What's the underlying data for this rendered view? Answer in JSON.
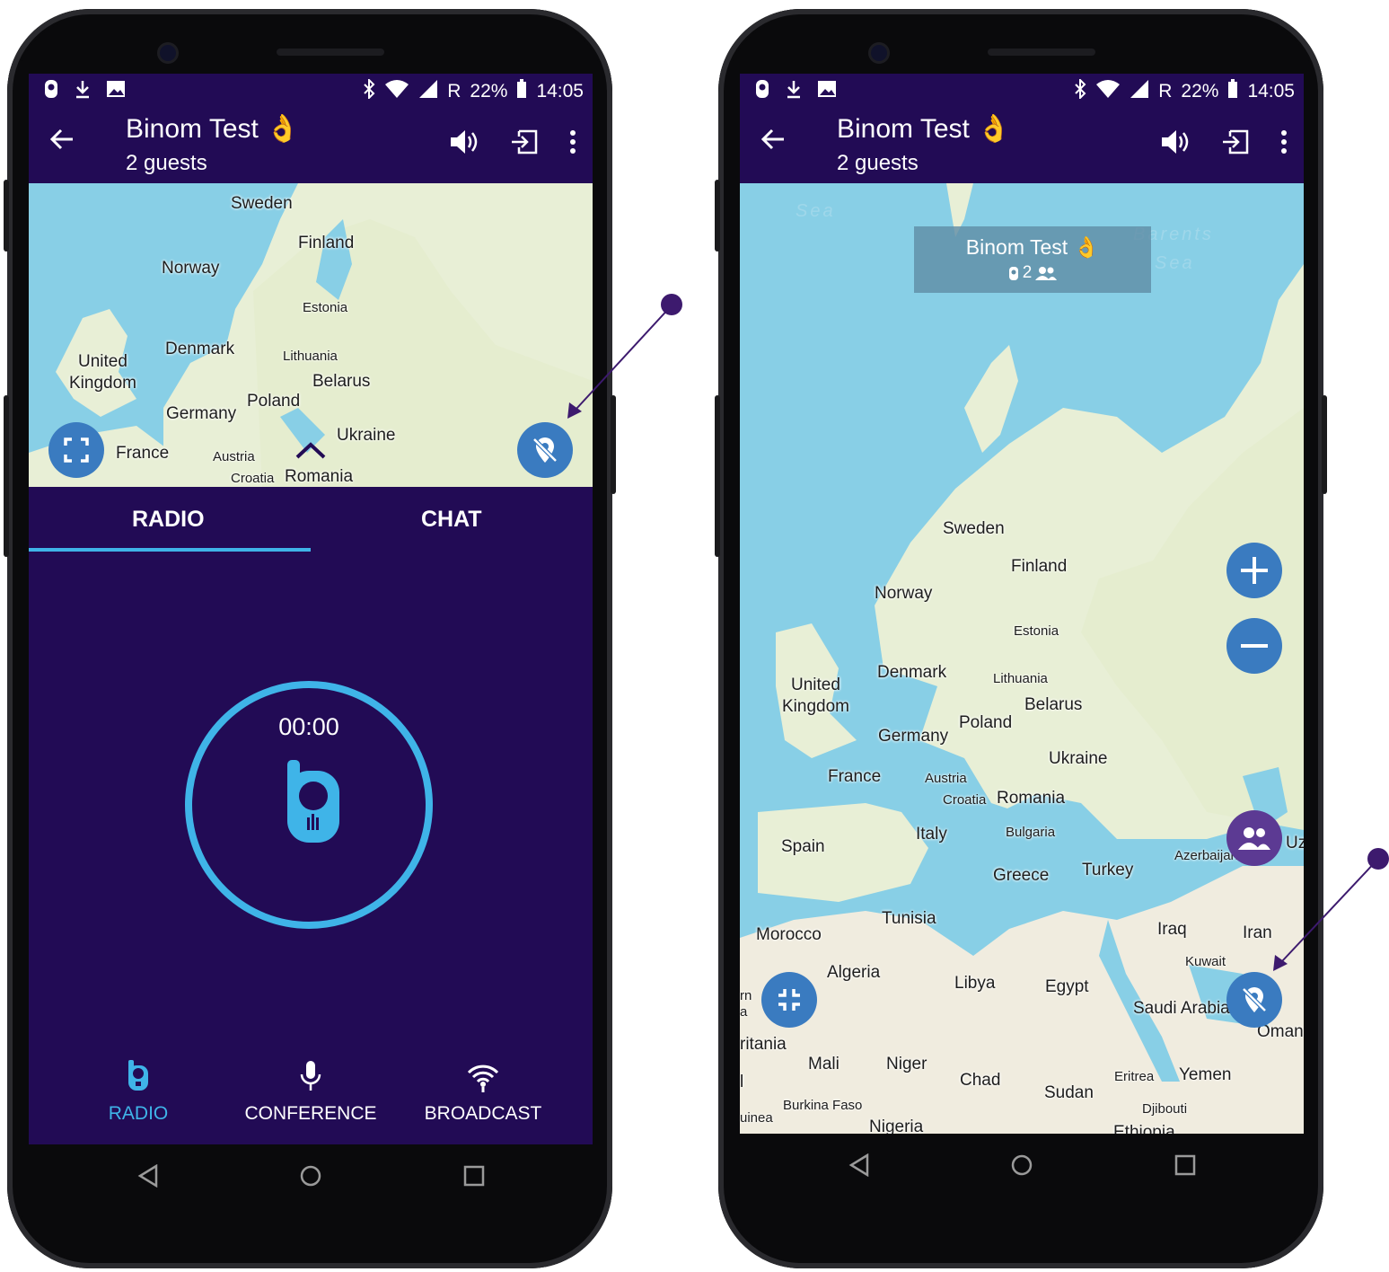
{
  "colors": {
    "primary": "#220b55",
    "accent": "#3fb4e8",
    "fab": "#3a7bc0",
    "pointer": "#3d1a6e"
  },
  "status": {
    "battery": "22%",
    "roaming": "R",
    "time": "14:05"
  },
  "appbar": {
    "title": "Binom Test",
    "subtitle": "2 guests",
    "emoji": "👌"
  },
  "left_phone": {
    "map_labels": [
      "Sweden",
      "Finland",
      "Norway",
      "Estonia",
      "Denmark",
      "Lithuania",
      "United",
      "Kingdom",
      "Belarus",
      "Poland",
      "Germany",
      "Ukraine",
      "France",
      "Austria",
      "Croatia",
      "Romania"
    ],
    "tabs": [
      {
        "label": "RADIO",
        "selected": true
      },
      {
        "label": "CHAT",
        "selected": false
      }
    ],
    "timer": "00:00",
    "bottom_nav": [
      {
        "label": "RADIO",
        "icon": "walkie-talkie-icon",
        "selected": true
      },
      {
        "label": "CONFERENCE",
        "icon": "microphone-icon",
        "selected": false
      },
      {
        "label": "BROADCAST",
        "icon": "broadcast-icon",
        "selected": false
      }
    ]
  },
  "right_phone": {
    "group_label": {
      "title": "Binom Test",
      "count": "2"
    },
    "seas": [
      "Sea",
      "Barents",
      "Sea"
    ],
    "map_labels": [
      "Sweden",
      "Finland",
      "Norway",
      "Estonia",
      "United",
      "Kingdom",
      "Denmark",
      "Lithuania",
      "Belarus",
      "Germany",
      "Poland",
      "Ukraine",
      "France",
      "Austria",
      "Croatia",
      "Romania",
      "Bulgaria",
      "Italy",
      "Spain",
      "Azerbaijan",
      "Uz",
      "Greece",
      "Turkey",
      "Tunisia",
      "Morocco",
      "Iraq",
      "Iran",
      "Kuwait",
      "Algeria",
      "Libya",
      "Egypt",
      "Saudi Arabia",
      "Oman",
      "rn",
      "a",
      "ritania",
      "Mali",
      "Niger",
      "Chad",
      "Sudan",
      "Eritrea",
      "Yemen",
      "l",
      "Burkina Faso",
      "Djibouti",
      "uinea",
      "Nigeria",
      "Ethiopia"
    ]
  }
}
